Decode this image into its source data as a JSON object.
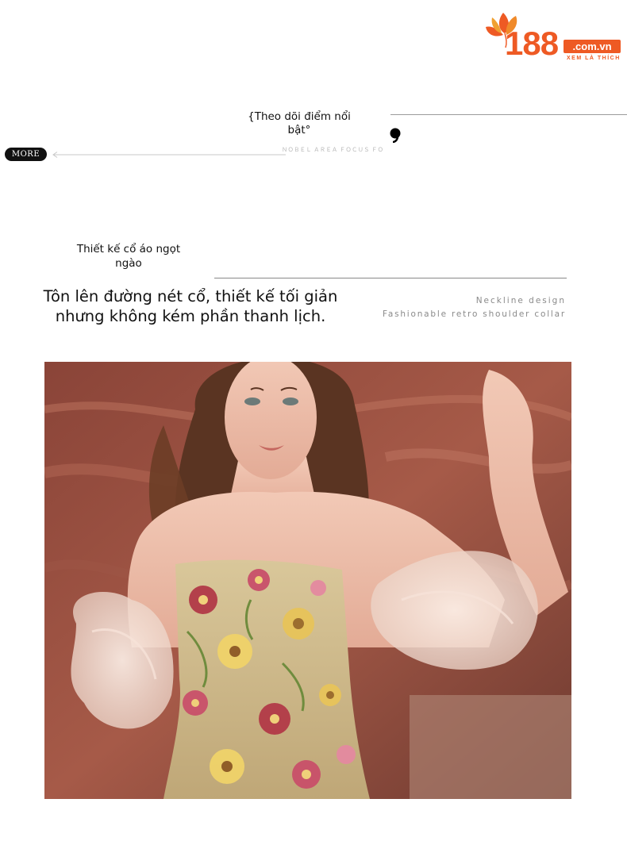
{
  "brand": {
    "number": "188",
    "domain": ".com.vn",
    "tagline": "XEM LÀ THÍCH",
    "color": "#ee5a24"
  },
  "header": {
    "follow_title": "{Theo dõi điểm nổi bật°",
    "more_label": "MORE",
    "faded_text": "ＮＯＢＥＬ ＡＲＥＡ ＦＯＣＵＳ ＦＯＬＬＯＷ ＮＯ"
  },
  "section": {
    "title": "Thiết kế cổ áo ngọt ngào",
    "headline": "Tôn lên đường nét cổ, thiết kế tối giản nhưng không kém phần thanh lịch.",
    "en_label_1": "Neckline design",
    "en_label_2": "Fashionable retro shoulder collar"
  },
  "photo": {
    "description_icon": "model-photo"
  }
}
